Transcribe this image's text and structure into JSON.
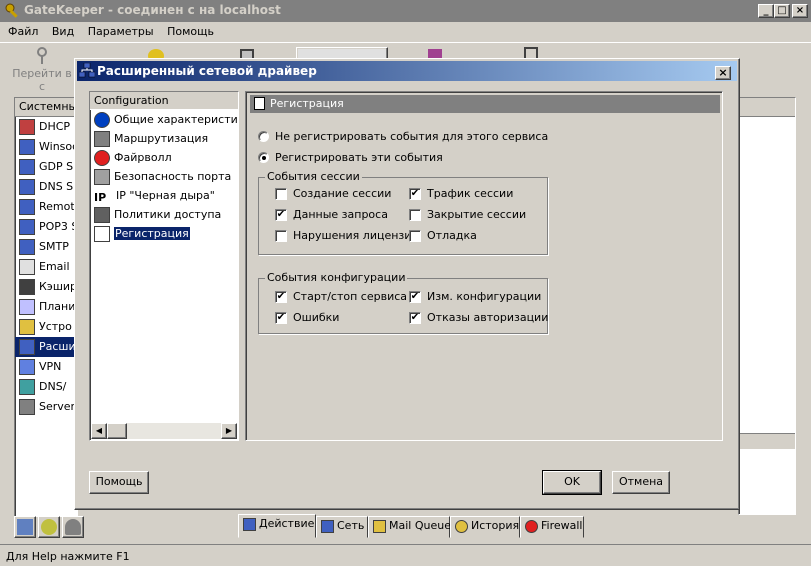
{
  "main_window": {
    "title": "GateKeeper - соединен с на localhost",
    "menu": [
      "Файл",
      "Вид",
      "Параметры",
      "Помощь"
    ],
    "toolbar_first_label": "Перейти в с"
  },
  "systems_header": "Системны",
  "systems": [
    {
      "label": "DHCP",
      "icon": "dhcp-icon"
    },
    {
      "label": "Winsoc",
      "icon": "network-icon"
    },
    {
      "label": "GDP S",
      "icon": "network-icon"
    },
    {
      "label": "DNS S",
      "icon": "network-icon"
    },
    {
      "label": "Remote",
      "icon": "network-icon"
    },
    {
      "label": "POP3 S",
      "icon": "network-icon"
    },
    {
      "label": "SMTP",
      "icon": "network-icon"
    },
    {
      "label": "Email",
      "icon": "email-icon"
    },
    {
      "label": "Кэшир",
      "icon": "cache-icon"
    },
    {
      "label": "Плани",
      "icon": "calendar-icon"
    },
    {
      "label": "Устро",
      "icon": "device-icon"
    },
    {
      "label": "Расши",
      "icon": "network-icon",
      "selected": true
    },
    {
      "label": "VPN",
      "icon": "vpn-icon"
    },
    {
      "label": "DNS/",
      "icon": "dns-icon"
    },
    {
      "label": "Server",
      "icon": "server-icon"
    }
  ],
  "dialog": {
    "title": "Расширенный сетевой драйвер",
    "tree_header": "Configuration",
    "tree_items": [
      {
        "label": "Общие характеристики",
        "icon": "info-icon"
      },
      {
        "label": "Маршрутизация",
        "icon": "routing-icon"
      },
      {
        "label": "Файрволл",
        "icon": "firewall-icon"
      },
      {
        "label": "Безопасность порта",
        "icon": "port-icon"
      },
      {
        "label": "IP \"Черная дыра\"",
        "icon": "ip-icon"
      },
      {
        "label": "Политики доступа",
        "icon": "policy-icon"
      },
      {
        "label": "Регистрация",
        "icon": "document-icon",
        "selected": true
      }
    ],
    "pane_title": "Регистрация",
    "radio1": "Не регистрировать события для этого сервиса",
    "radio2": "Регистрировать эти события",
    "radio_selected": 2,
    "session_group": "События сессии",
    "session_events": [
      {
        "label": "Создание сессии",
        "checked": false
      },
      {
        "label": "Трафик сессии",
        "checked": true
      },
      {
        "label": "Данные запроса",
        "checked": true
      },
      {
        "label": "Закрытие сессии",
        "checked": false
      },
      {
        "label": "Нарушения лицензии",
        "checked": false
      },
      {
        "label": "Отладка",
        "checked": false
      }
    ],
    "config_group": "События конфигурации",
    "config_events": [
      {
        "label": "Старт/стоп сервиса",
        "checked": true
      },
      {
        "label": "Изм. конфигурации",
        "checked": true
      },
      {
        "label": "Ошибки",
        "checked": true
      },
      {
        "label": "Отказы авторизации",
        "checked": true
      }
    ],
    "help_button": "Помощь",
    "ok_button": "OK",
    "cancel_button": "Отмена"
  },
  "bottom_tabs": [
    {
      "label": "Действие",
      "icon": "action-icon"
    },
    {
      "label": "Сеть",
      "icon": "network-icon"
    },
    {
      "label": "Mail Queue",
      "icon": "mail-icon"
    },
    {
      "label": "История",
      "icon": "clock-icon"
    },
    {
      "label": "Firewall",
      "icon": "firewall-icon"
    }
  ],
  "status": "Для Help нажмите F1"
}
